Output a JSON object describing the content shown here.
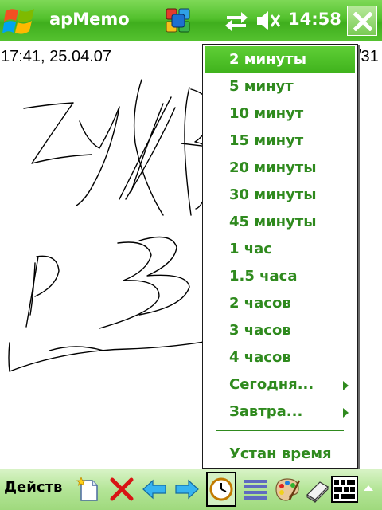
{
  "titlebar": {
    "app_title": "apMemo",
    "clock": "14:58",
    "icons": [
      "windows-logo-icon",
      "activesync-icon",
      "network-icon",
      "speaker-muted-icon",
      "close-icon"
    ]
  },
  "memo": {
    "timestamp": "17:41, 25.04.07",
    "partial_text": "/31"
  },
  "menu": {
    "items": [
      {
        "label": "2 минуты",
        "selected": true
      },
      {
        "label": "5 минут"
      },
      {
        "label": "10 минут"
      },
      {
        "label": "15 минут"
      },
      {
        "label": "20 минуты"
      },
      {
        "label": "30 минуты"
      },
      {
        "label": "45 минуты"
      },
      {
        "label": "1 час"
      },
      {
        "label": "1.5 часа"
      },
      {
        "label": "2 часов"
      },
      {
        "label": "3 часов"
      },
      {
        "label": "4 часов"
      },
      {
        "label": "Сегодня...",
        "submenu": true
      },
      {
        "label": "Завтра...",
        "submenu": true
      }
    ],
    "footer_item": "Устан время",
    "colors": {
      "text": "#2f8a1e",
      "selected_bg": "#4cbf26",
      "selected_text": "#ffffff"
    }
  },
  "toolbar": {
    "actions_label": "Действ",
    "icons": [
      "new-memo-icon",
      "delete-icon",
      "back-arrow-icon",
      "forward-arrow-icon",
      "alarm-clock-icon",
      "lines-icon",
      "palette-icon",
      "eraser-icon",
      "keyboard-icon"
    ]
  }
}
